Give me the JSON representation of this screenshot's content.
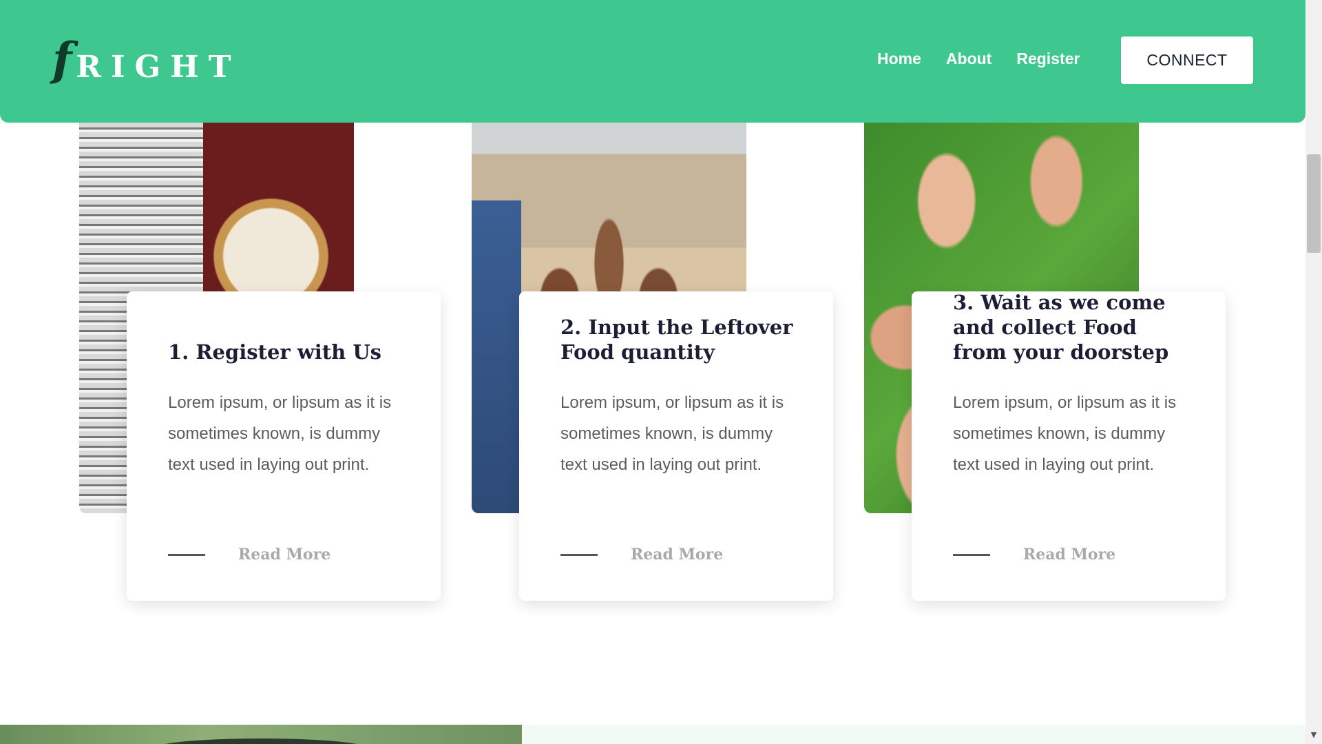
{
  "header": {
    "logo_f": "f",
    "logo_rest": "RIGHT",
    "nav": [
      "Home",
      "About",
      "Register"
    ],
    "connect_label": "CONNECT",
    "background_color": "#3ec88f"
  },
  "steps": [
    {
      "title": "1. Register with Us",
      "text": "Lorem ipsum, or lipsum as it is sometimes known, is dummy text used in laying out print.",
      "read_more": "Read More",
      "image": "stacked-coins"
    },
    {
      "title": "2. Input the Leftover Food quantity",
      "text": "Lorem ipsum, or lipsum as it is sometimes known, is dummy text used in laying out print.",
      "read_more": "Read More",
      "image": "group-of-children"
    },
    {
      "title": "3. Wait as we come and collect Food from your doorstep",
      "text": "Lorem ipsum, or lipsum as it is sometimes known, is dummy text used in laying out print.",
      "read_more": "Read More",
      "image": "hands-on-grass"
    }
  ],
  "icons": {
    "scroll_down": "chevron-down-icon"
  },
  "colors": {
    "accent": "#3ec88f",
    "title_text": "#1c1f33",
    "body_text": "#5c5c5c",
    "read_more": "#a9a9a9"
  }
}
